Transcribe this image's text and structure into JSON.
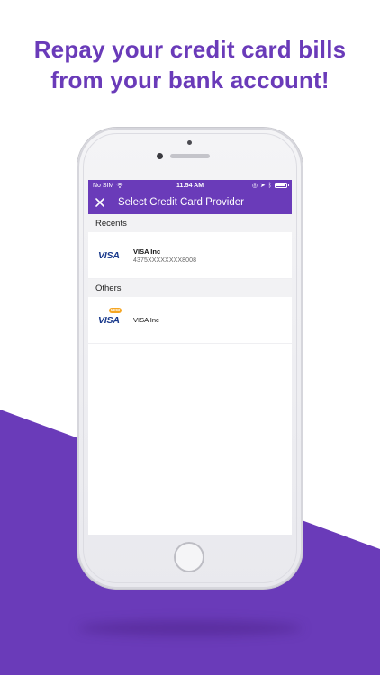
{
  "headline": {
    "line1": "Repay your credit card bills",
    "line2": "from your bank account!"
  },
  "colors": {
    "accent": "#6a3bb9",
    "visa_blue": "#1a3a8c",
    "badge": "#f5a623"
  },
  "status_bar": {
    "carrier": "No SIM",
    "time": "11:54 AM"
  },
  "app_bar": {
    "title": "Select Credit Card Provider",
    "close_icon": "close-icon"
  },
  "sections": {
    "recents": {
      "title": "Recents",
      "items": [
        {
          "logo": "VISA",
          "name": "VISA Inc",
          "number": "4375XXXXXXXX8008"
        }
      ]
    },
    "others": {
      "title": "Others",
      "items": [
        {
          "logo": "VISA",
          "badge": "NEW",
          "name": "VISA Inc"
        }
      ]
    }
  }
}
